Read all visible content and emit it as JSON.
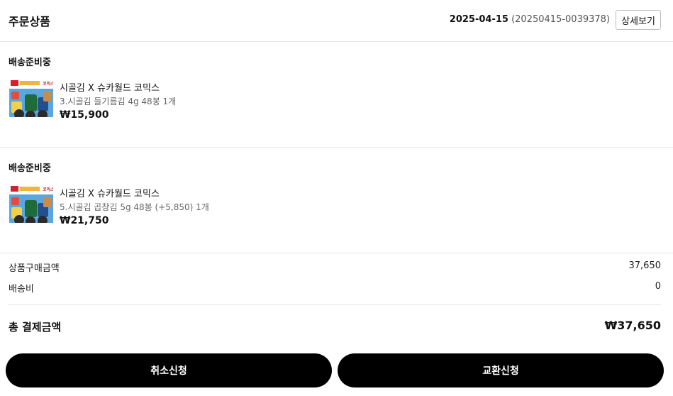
{
  "header": {
    "title": "주문상품",
    "order_date": "2025-04-15",
    "order_number": "(20250415-0039378)",
    "detail_button": "상세보기"
  },
  "orders": [
    {
      "status": "배송준비중",
      "product_name": "시골김 X 슈카월드 코믹스",
      "option": "3.시골김 들기름김 4g 48봉 1개",
      "price": "₩15,900",
      "thumbnail_badge": "코믹스"
    },
    {
      "status": "배송준비중",
      "product_name": "시골김 X 슈카월드 코믹스",
      "option": "5.시골김 곱창김 5g 48봉 (+5,850) 1개",
      "price": "₩21,750",
      "thumbnail_badge": "코믹스"
    }
  ],
  "summary": {
    "product_amount_label": "상품구매금액",
    "product_amount_value": "37,650",
    "shipping_label": "배송비",
    "shipping_value": "0",
    "total_label": "총 결제금액",
    "total_value": "₩37,650"
  },
  "actions": {
    "cancel_label": "취소신청",
    "exchange_label": "교환신청"
  },
  "colors": {
    "button_bg": "#000000",
    "divider": "#e6e6e6",
    "thumbnail_bg": "#5aa7e0"
  }
}
